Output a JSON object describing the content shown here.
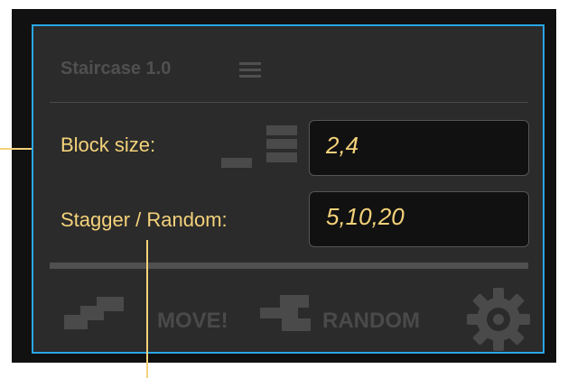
{
  "panel": {
    "title": "Staircase 1.0",
    "accent_color": "#29a6e6",
    "label_color": "#f4d27a"
  },
  "fields": {
    "block_size_label": "Block size:",
    "block_size_value": "2,4",
    "stagger_label": "Stagger / Random:",
    "stagger_value": "5,10,20"
  },
  "actions": {
    "move_label": "MOVE!",
    "random_label": "RANDOM"
  },
  "icons": {
    "menu": "hamburger-menu-icon",
    "block_size": "bars-icon",
    "move": "staircase-icon",
    "random": "random-stair-icon",
    "settings": "gear-icon"
  }
}
